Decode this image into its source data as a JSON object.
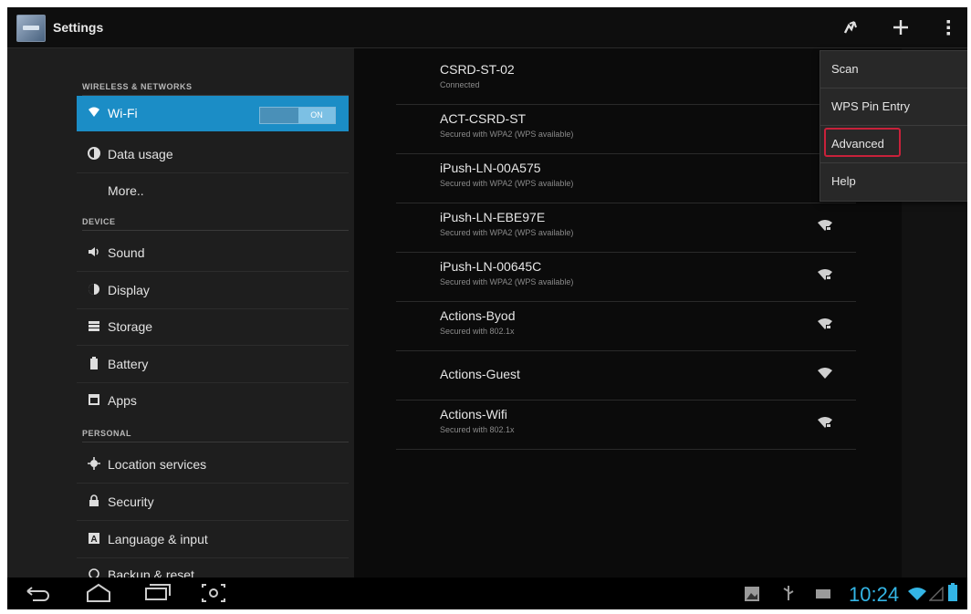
{
  "action_bar": {
    "title": "Settings",
    "icons": [
      "settings-app-icon",
      "wps-push-icon",
      "add-network-icon",
      "overflow-menu-icon"
    ]
  },
  "sidebar": {
    "categories": [
      {
        "label": "WIRELESS & NETWORKS"
      },
      {
        "label": "DEVICE"
      },
      {
        "label": "PERSONAL"
      }
    ],
    "items": [
      {
        "label": "Wi-Fi",
        "icon": "wifi-icon",
        "selected": true,
        "toggle": "ON"
      },
      {
        "label": "Data usage",
        "icon": "data-usage-icon"
      },
      {
        "label": "More..",
        "icon": ""
      },
      {
        "label": "Sound",
        "icon": "speaker-icon"
      },
      {
        "label": "Display",
        "icon": "display-icon"
      },
      {
        "label": "Storage",
        "icon": "storage-icon"
      },
      {
        "label": "Battery",
        "icon": "battery-icon"
      },
      {
        "label": "Apps",
        "icon": "apps-icon"
      },
      {
        "label": "Location services",
        "icon": "location-icon"
      },
      {
        "label": "Security",
        "icon": "lock-icon"
      },
      {
        "label": "Language & input",
        "icon": "language-icon"
      },
      {
        "label": "Backup & reset",
        "icon": "backup-icon"
      }
    ]
  },
  "networks": [
    {
      "ssid": "CSRD-ST-02",
      "status": "Connected"
    },
    {
      "ssid": "ACT-CSRD-ST",
      "status": "Secured with WPA2 (WPS available)"
    },
    {
      "ssid": "iPush-LN-00A575",
      "status": "Secured with WPA2 (WPS available)"
    },
    {
      "ssid": "iPush-LN-EBE97E",
      "status": "Secured with WPA2 (WPS available)"
    },
    {
      "ssid": "iPush-LN-00645C",
      "status": "Secured with WPA2 (WPS available)"
    },
    {
      "ssid": "Actions-Byod",
      "status": "Secured with 802.1x"
    },
    {
      "ssid": "Actions-Guest",
      "status": ""
    },
    {
      "ssid": "Actions-Wifi",
      "status": "Secured with 802.1x"
    }
  ],
  "overflow_menu": {
    "items": [
      "Scan",
      "WPS Pin Entry",
      "Advanced",
      "Help"
    ],
    "highlighted": "Advanced",
    "highlight_color": "#c8213a"
  },
  "nav_bar": {
    "time": "10:24",
    "accent_color": "#33b5e5"
  },
  "colors": {
    "selection": "#1b8dc6"
  }
}
